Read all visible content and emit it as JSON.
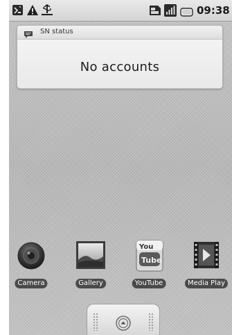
{
  "status_bar": {
    "time": "09:38",
    "left_icons": [
      "usb-debugging-icon",
      "warning-icon",
      "usb-connection-icon"
    ],
    "right_icons": [
      "sim-card-icon",
      "signal-icon",
      "battery-icon"
    ]
  },
  "widget": {
    "title": "SN status",
    "message": "No accounts",
    "icon": "chat-bubble-icon"
  },
  "shortcuts": [
    {
      "label": "Camera",
      "icon": "camera-icon"
    },
    {
      "label": "Gallery",
      "icon": "gallery-icon"
    },
    {
      "label": "YouTube",
      "icon": "youtube-icon"
    },
    {
      "label": "Media Play",
      "icon": "media-player-icon"
    }
  ],
  "launcher": {
    "icon": "launcher-up-icon"
  }
}
